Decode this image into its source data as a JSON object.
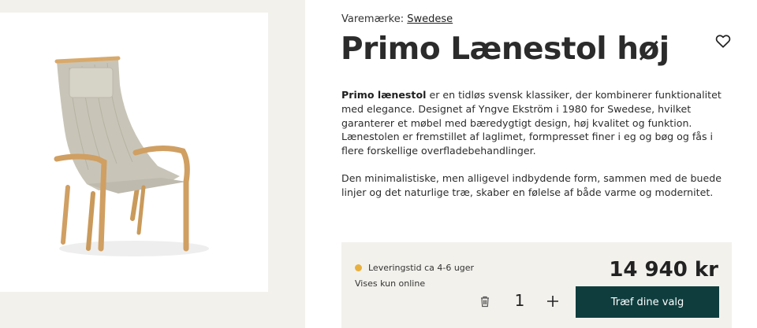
{
  "brand": {
    "label": "Varemærke:",
    "name": "Swedese"
  },
  "product": {
    "title": "Primo Lænestol høj",
    "description_bold": "Primo lænestol",
    "description_rest": " er en tidløs svensk klassiker, der kombinerer funktionalitet med elegance. Designet af Yngve Ekström i 1980 for Swedese, hvilket garanterer et møbel med bæredygtigt design, høj kvalitet og funktion. Lænestolen er fremstillet af laglimet, formpresset finer i eg og bøg og fås i flere forskellige overfladebehandlinger.",
    "description_2": "Den minimalistiske, men alligevel indbydende form, sammen med de buede linjer og det naturlige træ, skaber en følelse af både varme og modernitet."
  },
  "purchase": {
    "delivery": "Leveringstid ca 4-6 uger",
    "availability": "Vises kun online",
    "price": "14 940 kr",
    "quantity": "1",
    "cta_label": "Træf dine valg"
  },
  "icons": {
    "wishlist": "heart-icon",
    "remove": "trash-icon",
    "increment": "plus-icon"
  },
  "colors": {
    "accent_dark": "#0f3d3e",
    "status_dot": "#e8b03f",
    "panel_bg": "#f3f1ec"
  }
}
